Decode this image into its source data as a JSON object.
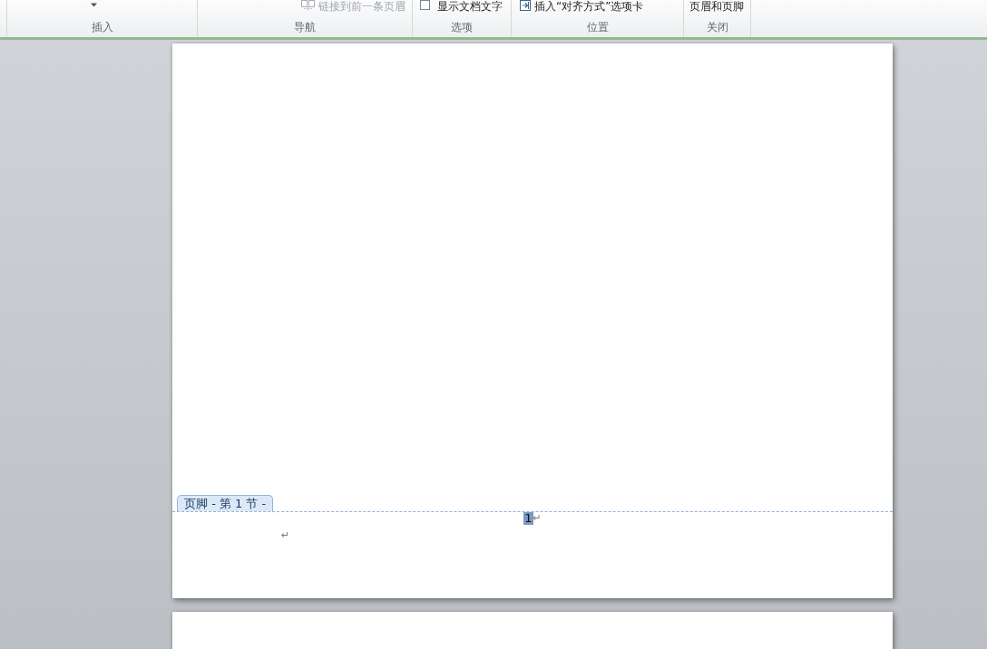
{
  "ribbon": {
    "groups": [
      {
        "label": "插入",
        "controls": [
          {
            "kind": "dropdown",
            "disabled": false
          }
        ]
      },
      {
        "label": "导航",
        "controls": [
          {
            "kind": "button",
            "text": "链接到前一条页眉",
            "disabled": true
          }
        ]
      },
      {
        "label": "选项",
        "controls": [
          {
            "kind": "checkbox",
            "text": "显示文档文字",
            "checked": false,
            "disabled": false
          }
        ]
      },
      {
        "label": "位置",
        "controls": [
          {
            "kind": "button",
            "text": "插入“对齐方式”选项卡",
            "disabled": false
          }
        ]
      },
      {
        "label": "关闭",
        "controls": [
          {
            "kind": "button",
            "text": "页眉和页脚",
            "disabled": false
          }
        ]
      }
    ]
  },
  "document": {
    "footer": {
      "tab_label": "页脚 - 第 1 节 -",
      "page_number": {
        "text": "1",
        "selected": true,
        "paragraph_mark": "↵"
      },
      "empty_paragraph": {
        "paragraph_mark": "↵"
      }
    }
  }
}
